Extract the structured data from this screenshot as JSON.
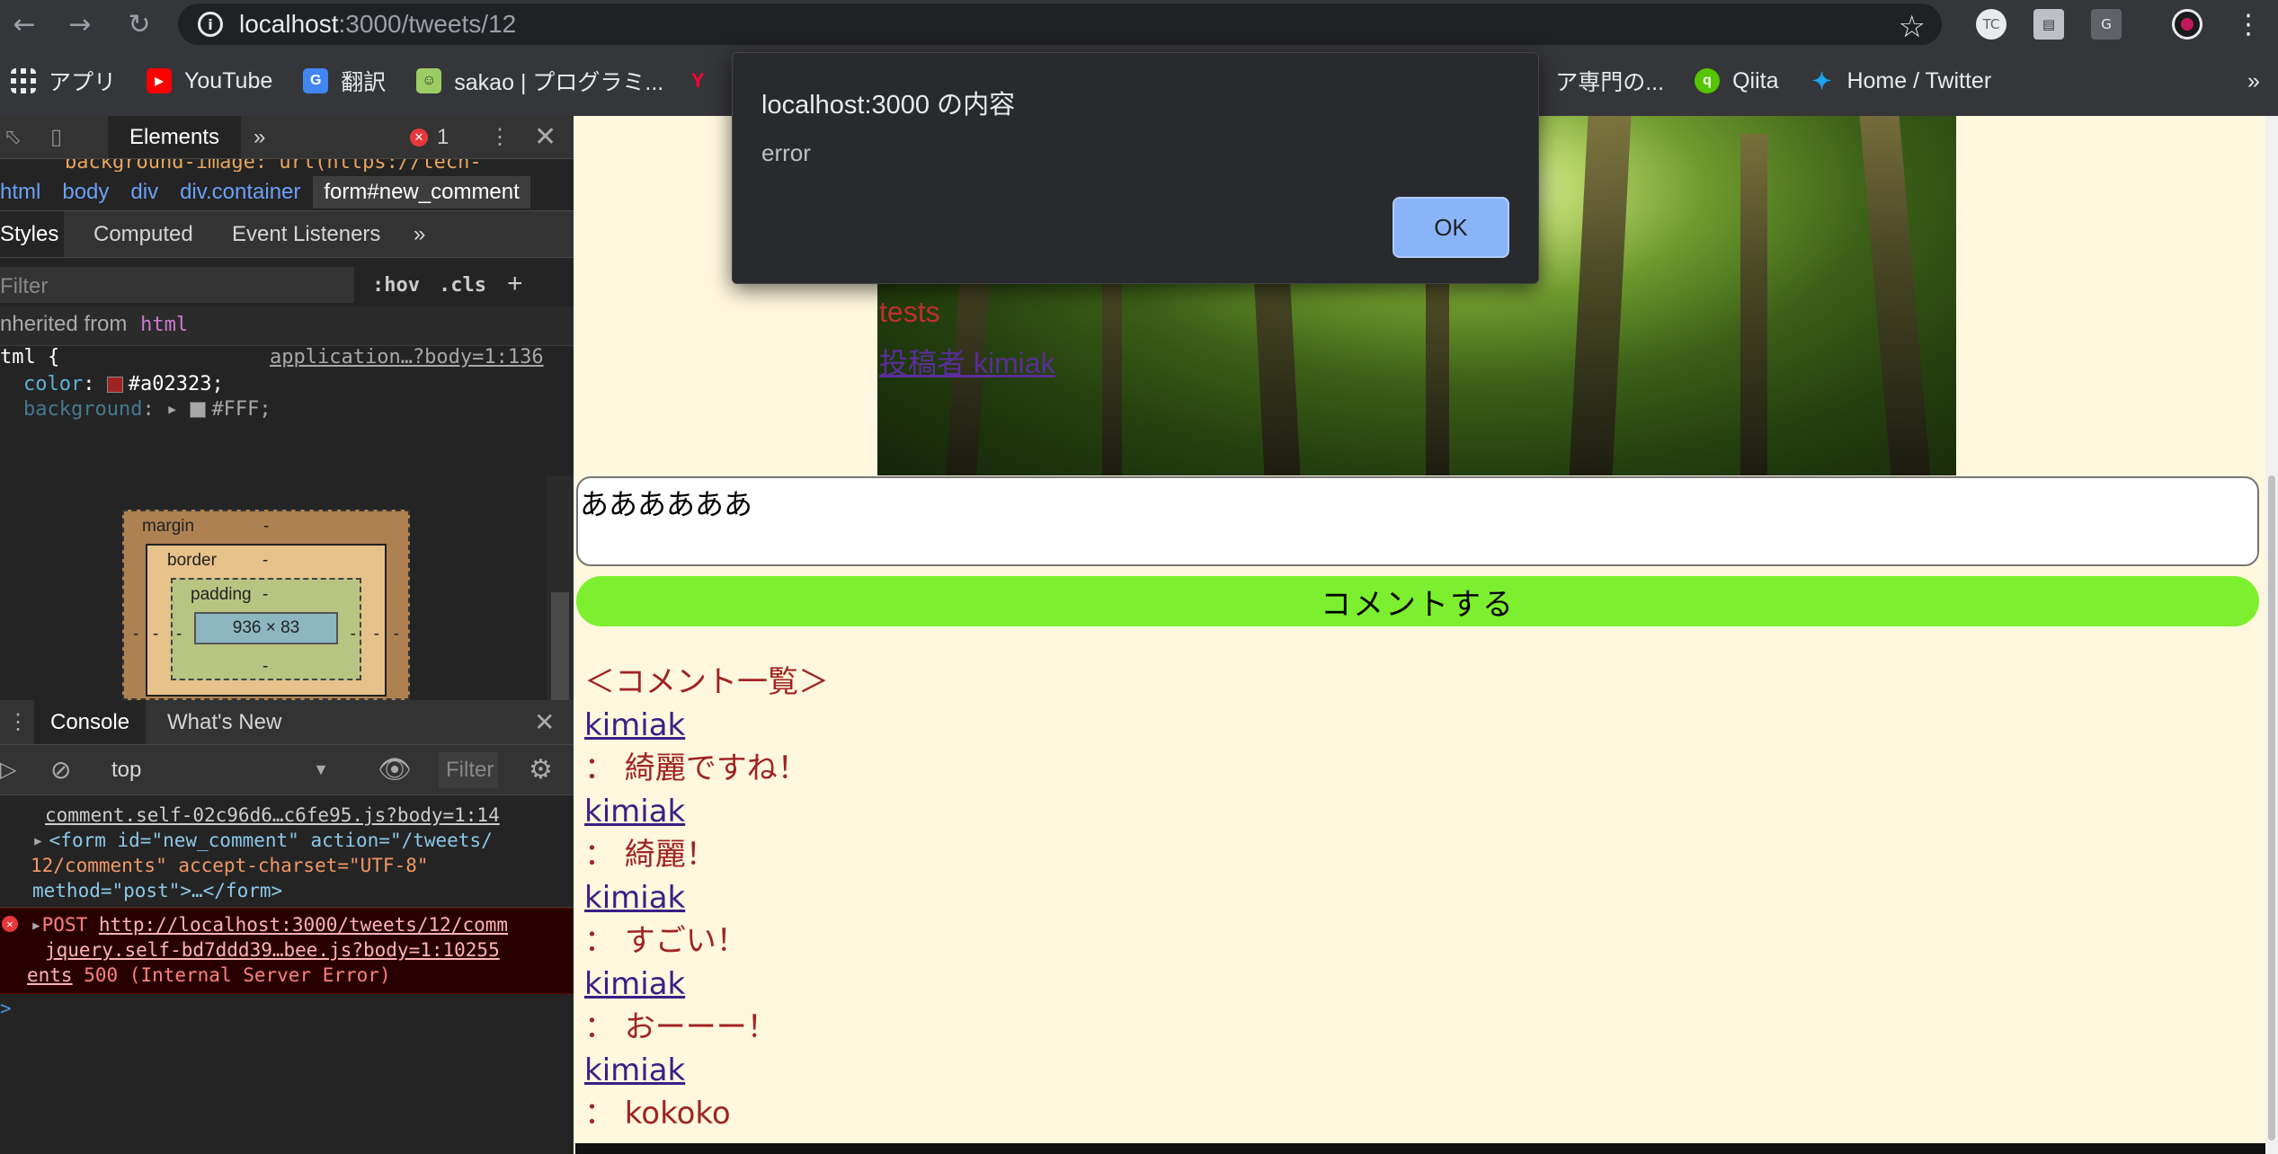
{
  "browser": {
    "url_host": "localhost",
    "url_path": ":3000/tweets/12",
    "extensions": [
      "TC",
      "G"
    ],
    "bookmarks": [
      {
        "label": "アプリ",
        "icon": "apps-grid-icon"
      },
      {
        "label": "YouTube",
        "icon": "youtube-icon"
      },
      {
        "label": "翻訳",
        "icon": "translate-icon"
      },
      {
        "label": "sakao | プログラミ...",
        "icon": "site-icon"
      },
      {
        "label": "ア専門の...",
        "icon": "site-icon"
      },
      {
        "label": "Qiita",
        "icon": "qiita-icon"
      },
      {
        "label": "Home / Twitter",
        "icon": "twitter-icon"
      }
    ],
    "bookmarks_more": "»"
  },
  "alert": {
    "title": "localhost:3000 の内容",
    "message": "error",
    "ok_label": "OK"
  },
  "devtools": {
    "tabs": {
      "elements": "Elements",
      "more": "»",
      "error_count": "1"
    },
    "partial_line": "background-image: url(https://tech-",
    "breadcrumbs": [
      "html",
      "body",
      "div",
      "div.container",
      "form#new_comment"
    ],
    "style_tabs": [
      "Styles",
      "Computed",
      "Event Listeners",
      "»"
    ],
    "filter_placeholder": "Filter",
    "hov": ":hov",
    "cls": ".cls",
    "plus": "+",
    "inherited_prefix": "nherited from",
    "inherited_tag": "html",
    "rule_selector": "tml {",
    "rule_source": "application…?body=1:136",
    "prop1_name": "color",
    "prop1_value": "#a02323;",
    "prop2_name": "background",
    "prop2_value": "#FFF;",
    "box_model": {
      "margin_label": "margin",
      "border_label": "border",
      "padding_label": "padding",
      "dash": "-",
      "content_size": "936 × 83"
    },
    "console_tabs": [
      "Console",
      "What's New"
    ],
    "context": "top",
    "console_filter": "Filter",
    "console_lines": {
      "source1": "comment.self-02c96d6…c6fe95.js?body=1:14",
      "form_line1": "<form id=\"new_comment\" action=\"/tweets/",
      "form_line2": "12/comments\" accept-charset=\"UTF-8\"",
      "form_line3": "method=\"post\">…</form>",
      "err_prefix": "POST",
      "err_url": "http://localhost:3000/tweets/12/comm",
      "err_source": "jquery.self-bd7ddd39…bee.js?body=1:10255",
      "err_url2": "ents",
      "err_status": "500 (Internal Server Error)",
      "prompt": ">"
    }
  },
  "page": {
    "tweet_text": "tests",
    "tweet_user": "投稿者 kimiak",
    "comment_input_value": "ああああああ",
    "submit_label": "コメントする",
    "comments_heading": "＜コメント一覧＞",
    "comments": [
      {
        "user": "kimiak",
        "text": "： 綺麗ですね！"
      },
      {
        "user": "kimiak",
        "text": "： 綺麗！"
      },
      {
        "user": "kimiak",
        "text": "： すごい！"
      },
      {
        "user": "kimiak",
        "text": "： おーーー！"
      },
      {
        "user": "kimiak",
        "text": "： kokoko"
      }
    ]
  }
}
